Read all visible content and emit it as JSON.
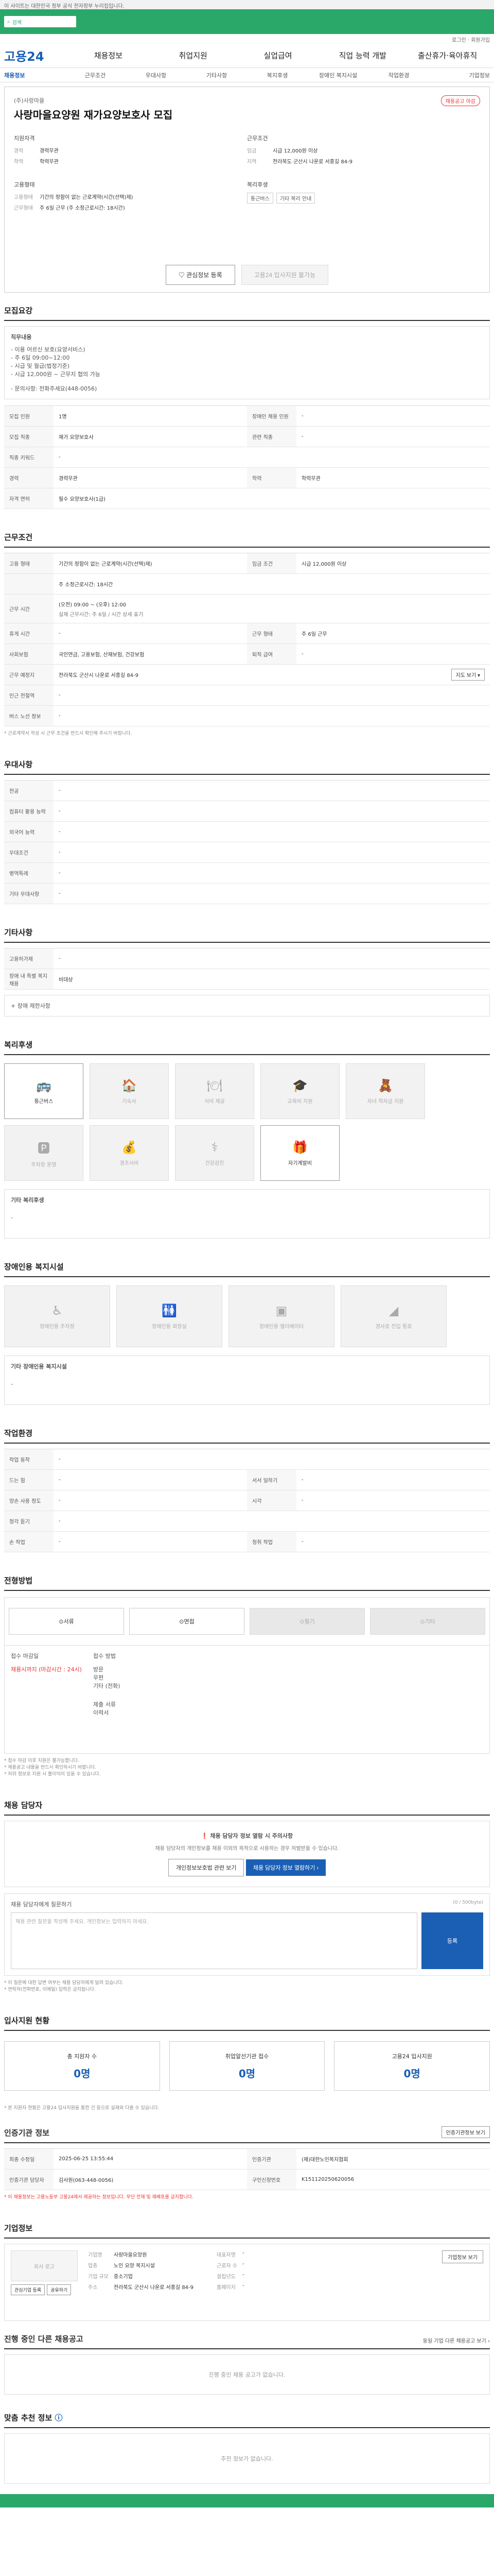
{
  "topbar": {
    "notice": "이 사이트는 대한민국 정부 공식 전자정부 누리집입니다."
  },
  "search": {
    "placeholder": "검색"
  },
  "util": {
    "links": "로그인 · 회원가입"
  },
  "gnb": {
    "logo": "고용24",
    "items": [
      "채용정보",
      "취업지원",
      "실업급여",
      "직업 능력 개발",
      "출산휴가·육아휴직"
    ]
  },
  "subnav": [
    "채용정보",
    "근무조건",
    "우대사항",
    "기타사항",
    "복지후생",
    "장애인 복지시설",
    "작업환경",
    "기업정보"
  ],
  "job": {
    "company": "(주)사랑마을",
    "title": "사랑마을요양원 재가요양보호사 모집",
    "status": "채용공고 마감",
    "apply_title": "지원자격",
    "apply_rows": [
      {
        "k": "경력",
        "v": "경력무관"
      },
      {
        "k": "학력",
        "v": "학력무관"
      }
    ],
    "cond_title": "근무조건",
    "cond_rows": [
      {
        "k": "임금",
        "v": "시급 12,000원 이상"
      },
      {
        "k": "지역",
        "v": "전라북도 군산시 나운로 서흥길 84-9"
      }
    ],
    "form_title": "고용형태",
    "form_rows": [
      {
        "k": "고용형태",
        "v": "기간의 정함이 없는 근로계약(시간(선택)제)"
      },
      {
        "k": "근무형태",
        "v": "주 6일 근무 (주 소정근로시간: 18시간)"
      }
    ],
    "welfare_title": "복리후생",
    "welfare_chips": [
      "통근버스",
      "기타 복리 안내"
    ],
    "btn_interest": "관심정보 등록",
    "btn_apply": "고용24 입사지원 불가능"
  },
  "recruit": {
    "title": "모집요강",
    "duty_label": "직무내용",
    "duty_lines": [
      "- 이용 어르신 보호(요양서비스)",
      "- 주 6일 09:00~12:00",
      "- 시급 및 월급(법정기준)",
      "- 시급 12,000원 ~ 근무지 협의 가능",
      "",
      "- 문의사항: 전화주세요(448-0056)"
    ],
    "rows": [
      {
        "th": "모집 인원",
        "td": "1명",
        "th2": "장애인 채용 인원",
        "td2": "-"
      },
      {
        "th": "모집 직종",
        "td": "재가 요양보호사",
        "th2": "관련 직종",
        "td2": "-"
      },
      {
        "th": "직종 키워드",
        "td": "-",
        "th2": "",
        "td2": ""
      },
      {
        "th": "경력",
        "td": "경력무관",
        "th2": "학력",
        "td2": "학력무관"
      },
      {
        "th": "자격 면허",
        "td": "필수 요양보호사(1급)",
        "th2": "",
        "td2": ""
      }
    ]
  },
  "workcond": {
    "title": "근무조건",
    "rows": [
      {
        "th": "고용 형태",
        "td": "기간의 정함이 없는 근로계약(시간(선택)제)",
        "th2": "임금 조건",
        "td2": "시급 12,000원 이상"
      },
      {
        "th": "",
        "td": "주 소정근로시간: 18시간",
        "th2": "",
        "td2": ""
      },
      {
        "th": "근무 시간",
        "td": "(오전) 09:00 ~ (오후) 12:00",
        "th2": "",
        "td2": ""
      },
      {
        "th": "",
        "td": "실제 근무시간: 주 6일 / 시간 상세 표기",
        "th2": "",
        "td2": ""
      },
      {
        "th": "휴게 시간",
        "td": "-",
        "th2": "근무 형태",
        "td2": "주 6일 근무"
      },
      {
        "th": "사회보험",
        "td": "국민연금, 고용보험, 산재보험, 건강보험",
        "th2": "퇴직 급여",
        "td2": "-"
      },
      {
        "th": "근무 예정지",
        "td": "전라북도 군산시 나운로 서흥길 84-9",
        "th2": "",
        "td2": ""
      },
      {
        "th": "인근 전철역",
        "td": "-",
        "th2": "",
        "td2": ""
      },
      {
        "th": "버스 노선 정보",
        "td": "-",
        "th2": "",
        "td2": ""
      }
    ],
    "map_btn": "지도 보기",
    "note": "* 근로계약서 작성 시 근무 조건을 반드시 확인해 주시기 바랍니다."
  },
  "pref": {
    "title": "우대사항",
    "rows": [
      "전공",
      "컴퓨터 활용 능력",
      "외국어 능력",
      "우대조건",
      "병역특례",
      "기타 우대사항"
    ]
  },
  "etc": {
    "title": "기타사항",
    "rows": [
      {
        "th": "고용허가제",
        "td": "-"
      },
      {
        "th": "장애 내 특별 복지 채용",
        "td": "비대상"
      }
    ],
    "more": "+ 장애 제한사항"
  },
  "welfare": {
    "title": "복리후생",
    "cards": [
      {
        "icon": "bus-icon",
        "glyph": "🚌",
        "label": "통근버스",
        "on": true
      },
      {
        "icon": "dorm-icon",
        "glyph": "🏠",
        "label": "기숙사",
        "on": false
      },
      {
        "icon": "meal-icon",
        "glyph": "🍽",
        "label": "식비 제공",
        "on": false
      },
      {
        "icon": "edu-icon",
        "glyph": "🎓",
        "label": "교육비 지원",
        "on": false
      },
      {
        "icon": "child-icon",
        "glyph": "🧸",
        "label": "자녀 학자금 지원",
        "on": false
      },
      {
        "icon": "parking-icon",
        "glyph": "🅿",
        "label": "주차장 운영",
        "on": false
      },
      {
        "icon": "money-icon",
        "glyph": "💰",
        "label": "경조사비",
        "on": false
      },
      {
        "icon": "health-icon",
        "glyph": "⚕",
        "label": "건강검진",
        "on": false
      },
      {
        "icon": "bonus-icon",
        "glyph": "🎁",
        "label": "자기계발비",
        "on": true
      }
    ],
    "other_label": "기타 복리후생",
    "other_value": "-"
  },
  "disabled": {
    "title": "장애인용 복지시설",
    "cards": [
      {
        "icon": "wheelchair-icon",
        "glyph": "♿",
        "label": "장애인용 주차장"
      },
      {
        "icon": "toilet-icon",
        "glyph": "🚻",
        "label": "장애인용 화장실"
      },
      {
        "icon": "elevator-icon",
        "glyph": "🛗",
        "label": "장애인용 엘리베이터"
      },
      {
        "icon": "ramp-icon",
        "glyph": "⛐",
        "label": "경사로 진입 통로"
      }
    ],
    "other_label": "기타 장애인용 복지시설",
    "other_value": "-"
  },
  "env": {
    "title": "작업환경",
    "rows": [
      {
        "th": "작업 동작",
        "td": "-",
        "th2": "",
        "td2": ""
      },
      {
        "th": "드는 힘",
        "td": "-",
        "th2": "서서 일하기",
        "td2": "-"
      },
      {
        "th": "양손 사용 정도",
        "td": "-",
        "th2": "시각",
        "td2": "-"
      },
      {
        "th": "청각 듣기",
        "td": "-",
        "th2": "",
        "td2": ""
      },
      {
        "th": "손 작업",
        "td": "-",
        "th2": "청취 작업",
        "td2": "-"
      }
    ]
  },
  "process": {
    "title": "전형방법",
    "steps": [
      {
        "label": "서류",
        "on": true
      },
      {
        "label": "면접",
        "on": true
      },
      {
        "label": "필기",
        "on": false
      },
      {
        "label": "기타",
        "on": false
      }
    ],
    "deadline_label": "접수 마감일",
    "deadline_value": "채용시까지 (마감시간 : 24시)",
    "method_label": "접수 방법",
    "method_lines": [
      "방문",
      "우편",
      "기타 (전화)"
    ],
    "docs_label": "제출 서류",
    "docs_value": "이력서",
    "warn_lines": [
      "* 접수 마감 이후 지원은 불가능합니다.",
      "* 채용공고 내용을 반드시 확인하시기 바랍니다.",
      "* 허위 정보로 지원 시 불이익이 있을 수 있습니다."
    ]
  },
  "contact": {
    "title": "채용 담당자",
    "alert": "채용 담당자 정보 열람 시 주의사항",
    "alert_body": "채용 담당자의 개인정보를 채용 이외의 목적으로 사용하는 경우 처벌받을 수 있습니다.",
    "btn_view": "개인정보보호법 관련 보기",
    "btn_show": "채용 담당자 정보 열람하기 ›",
    "inquiry_label": "채용 담당자에게 질문하기",
    "inquiry_placeholder": "채용 관련 질문을 작성해 주세요. 개인정보는 입력하지 마세요.",
    "inquiry_count": "(0 / 500byte)",
    "inquiry_btn": "등록",
    "inquiry_notes": [
      "* 이 질문에 대한 답변 여부는 채용 담당자에게 달려 있습니다.",
      "* 연락처(전화번호, 이메일) 입력은 금지됩니다."
    ]
  },
  "applicants": {
    "title": "입사지원 현황",
    "counters": [
      {
        "label": "총 지원자 수",
        "value": "0명"
      },
      {
        "label": "취업알선기관 접수",
        "value": "0명"
      },
      {
        "label": "고용24 입사지원",
        "value": "0명"
      }
    ],
    "note": "* 본 지원자 현황은 고용24 입사지원을 통한 건 등으로 실제와 다를 수 있습니다."
  },
  "cert": {
    "title": "인증기관 정보",
    "btn": "인증기관정보 보기",
    "rows": [
      {
        "th": "최종 수정일",
        "td": "2025-06-25 13:55:44",
        "th2": "인증기관",
        "td2": "(재)대한노인복지협회"
      },
      {
        "th": "인증기관 담당자",
        "td": "김사원(063-448-0056)",
        "th2": "구인신청번호",
        "td2": "K151120250620056"
      }
    ],
    "warn": "* 이 채용정보는 고용노동부 고용24에서 제공하는 정보입니다. 무단 전재 및 재배포를 금지합니다."
  },
  "company": {
    "title": "기업정보",
    "logo_text": "회사 로고",
    "btn_follow": "관심기업 등록",
    "btn_share": "공유하기",
    "btn_detail": "기업정보 보기",
    "rows": [
      {
        "k": "기업명",
        "v": "사랑마을요양원",
        "k2": "대표자명",
        "v2": "-"
      },
      {
        "k": "업종",
        "v": "노인 요양 복지시설",
        "k2": "근로자 수",
        "v2": "-"
      },
      {
        "k": "기업 규모",
        "v": "중소기업",
        "k2": "설립년도",
        "v2": "-"
      },
      {
        "k": "주소",
        "v": "전라북도 군산시 나운로 서흥길 84-9",
        "k2": "홈페이지",
        "v2": "-"
      }
    ]
  },
  "related": {
    "title": "진행 중인 다른 채용공고",
    "link": "동일 기업 다른 채용공고 보기 ›",
    "empty": "진행 중인 채용 공고가 없습니다."
  },
  "recommend": {
    "title": "맞춤 추천 정보",
    "empty": "추천 정보가 없습니다."
  },
  "colors": {
    "brand": "#2aa86a",
    "primary": "#1a5fb4",
    "alert": "#ee3333"
  }
}
